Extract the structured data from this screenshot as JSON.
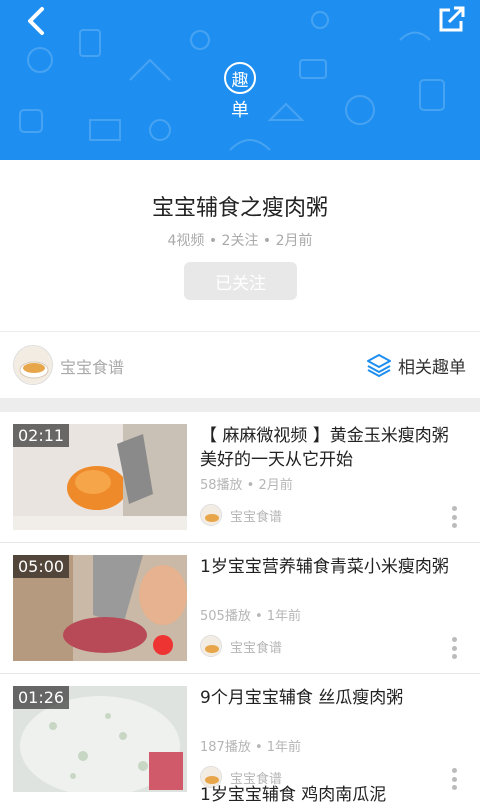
{
  "header": {
    "badge": "趣",
    "subtitle": "单"
  },
  "playlist": {
    "title": "宝宝辅食之瘦肉粥",
    "meta": "4视频 • 2关注 • 2月前",
    "follow_label": "已关注"
  },
  "author": {
    "name": "宝宝食谱",
    "related_label": "相关趣单"
  },
  "videos": [
    {
      "duration": "02:11",
      "title": "【 麻麻微视频 】黄金玉米瘦肉粥 美好的一天从它开始",
      "meta": "58播放 • 2月前",
      "author": "宝宝食谱"
    },
    {
      "duration": "05:00",
      "title": "1岁宝宝营养辅食青菜小米瘦肉粥",
      "meta": "505播放 • 1年前",
      "author": "宝宝食谱"
    },
    {
      "duration": "01:26",
      "title": "9个月宝宝辅食 丝瓜瘦肉粥",
      "meta": "187播放 • 1年前",
      "author": "宝宝食谱"
    }
  ],
  "peek_title": "1岁宝宝辅食 鸡肉南瓜泥",
  "colors": {
    "header_bg": "#1e8ff0",
    "accent": "#1e8ff0"
  }
}
